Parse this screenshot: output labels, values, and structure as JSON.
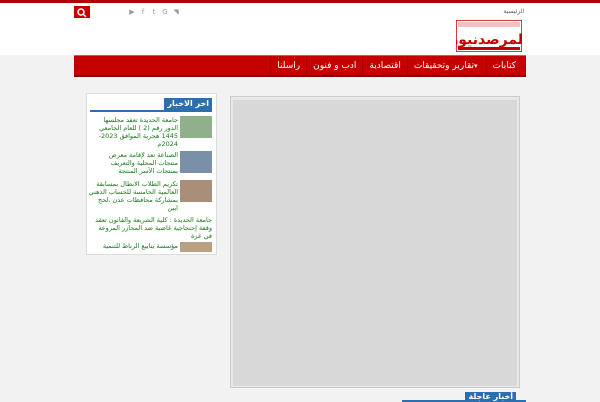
{
  "topbar": {
    "search_placeholder": "",
    "home_label": "الرئيسية",
    "social_icons": [
      "rss-icon",
      "google-plus-icon",
      "facebook-icon",
      "twitter-icon",
      "youtube-icon"
    ]
  },
  "header": {
    "logo_text": "المرصد نيوز"
  },
  "nav": {
    "items": [
      {
        "label": "كتابات"
      },
      {
        "label": "تقارير وتحقيقات"
      },
      {
        "label": "اقتصادية"
      },
      {
        "label": "ادب و فنون"
      },
      {
        "label": "راسلنا"
      }
    ]
  },
  "sidebar": {
    "title": "اخر الاخبار",
    "news": [
      {
        "text": "جامعة الحديدة تعقد مجلسها الدور رقم (2 ) للعام الجامعي 1445 هجرية الموافق 2023-2024م"
      },
      {
        "text": "الصناعة تعد لإقامة معرض منتجات المحلية والتعريف بمنتجات الأسر المنتجة"
      },
      {
        "text": "تكريم الطلاب الابطال بمسابقة العالمية الخامسة للحساب الذهني بمشاركة محافظات عدن ،لحج ابين"
      },
      {
        "text": "جامعة الحديدة : كلية الشريعة والقانون تعقد وقفة إحتجاجية غاضبة ضد المجازر المروعة في غزة"
      },
      {
        "text": "مؤسسة ينابيع الرباط للتنمية"
      }
    ]
  },
  "bottom": {
    "title": "أخبار عاجلة"
  }
}
